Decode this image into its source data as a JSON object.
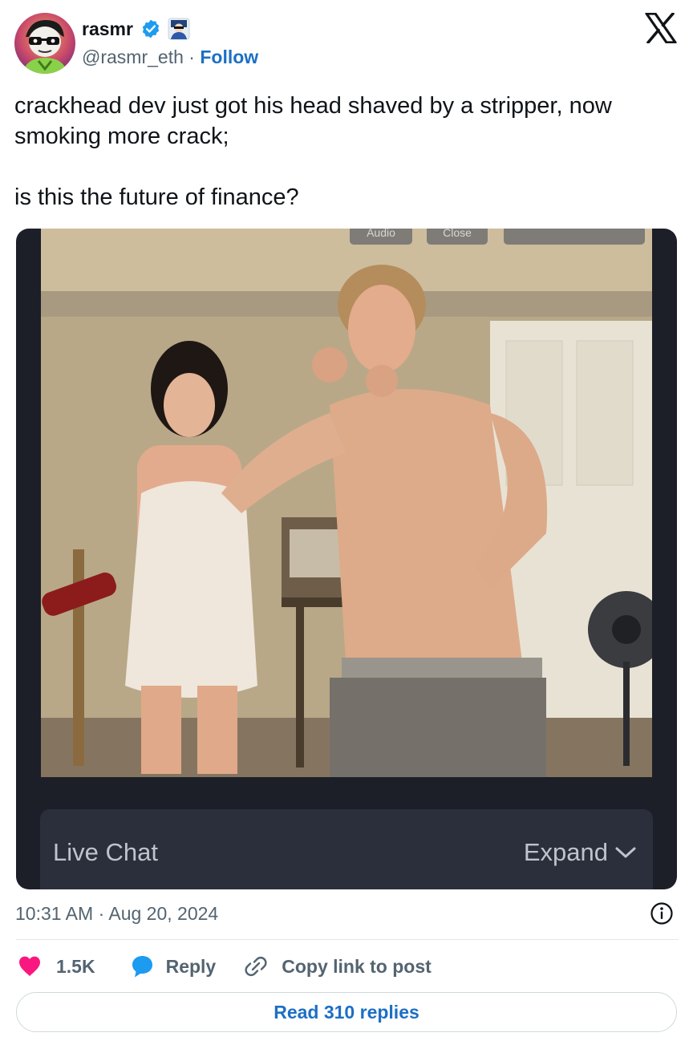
{
  "author": {
    "name": "rasmr",
    "handle": "@rasmr_eth",
    "separator": "·",
    "follow_label": "Follow",
    "verified_icon": "verified-badge-icon",
    "affiliate_icon": "affiliate-badge-icon"
  },
  "tweet": {
    "lines": [
      "crackhead dev just got his head shaved by a stripper, now smoking more crack;",
      "is this the future of finance?"
    ]
  },
  "media": {
    "overlay_buttons": [
      "Audio",
      "Close",
      ""
    ],
    "chat_label": "Live Chat",
    "expand_label": "Expand"
  },
  "footer": {
    "timestamp": "10:31 AM · Aug 20, 2024",
    "likes": "1.5K",
    "reply_label": "Reply",
    "copy_label": "Copy link to post",
    "read_replies": "Read 310 replies"
  },
  "colors": {
    "link": "#1d6fc4",
    "heart": "#f91880",
    "reply": "#1d9bf0",
    "muted": "#536471"
  }
}
